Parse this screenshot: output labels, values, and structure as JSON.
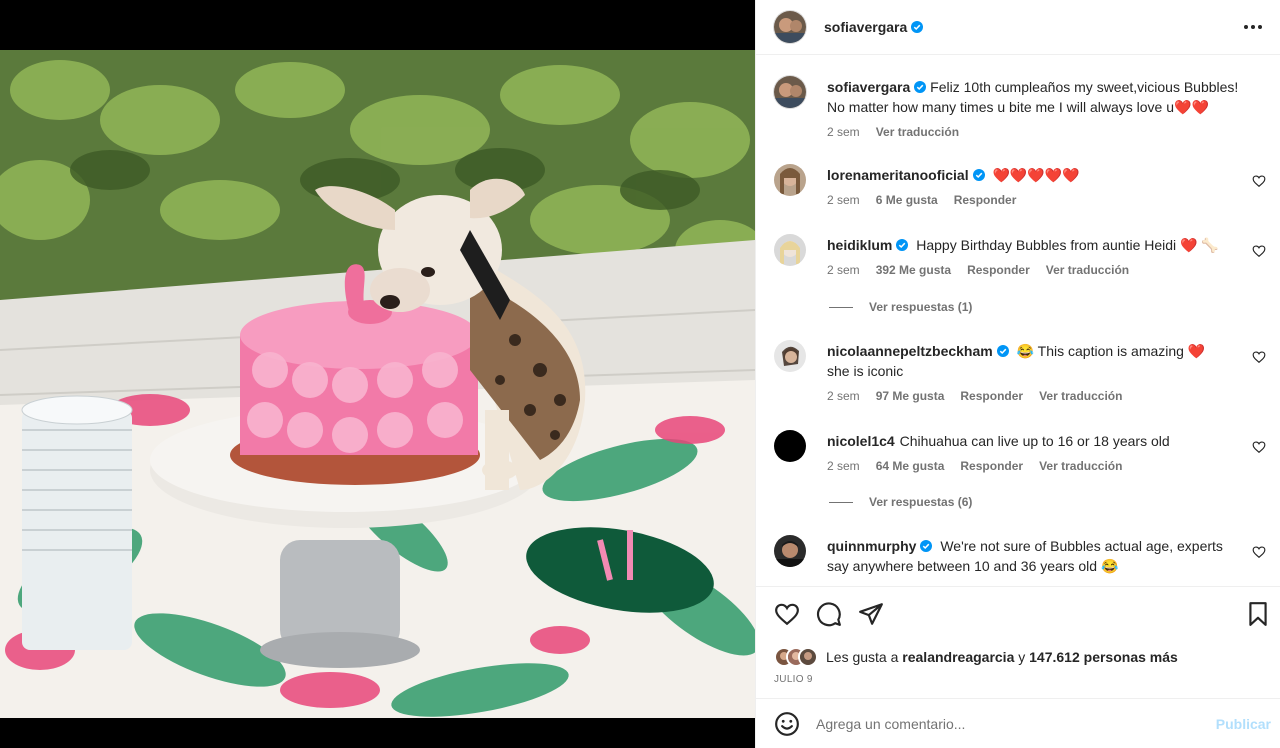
{
  "post": {
    "author": "sofiavergara",
    "caption_author": "sofiavergara",
    "caption_text": "Feliz 10th cumpleaños my sweet,vicious Bubbles! No matter how many times u bite me I will always love u",
    "caption_emoji": "❤️❤️",
    "caption_time": "2 sem",
    "caption_translate": "Ver traducción"
  },
  "comments": [
    {
      "user": "lorenameritanooficial",
      "verified": true,
      "text": "❤️❤️❤️❤️❤️",
      "time": "2 sem",
      "likes": "6 Me gusta",
      "reply": "Responder",
      "translate": ""
    },
    {
      "user": "heidiklum",
      "verified": true,
      "text": "Happy Birthday Bubbles from auntie Heidi ❤️ 🦴",
      "time": "2 sem",
      "likes": "392 Me gusta",
      "reply": "Responder",
      "translate": "Ver traducción",
      "view_replies": "Ver respuestas (1)"
    },
    {
      "user": "nicolaannepeltzbeckham",
      "verified": true,
      "text": "😂 This caption is amazing ❤️ she is iconic",
      "time": "2 sem",
      "likes": "97 Me gusta",
      "reply": "Responder",
      "translate": "Ver traducción"
    },
    {
      "user": "nicolel1c4",
      "verified": false,
      "text": "Chihuahua can live up to 16 or 18 years old",
      "time": "2 sem",
      "likes": "64 Me gusta",
      "reply": "Responder",
      "translate": "Ver traducción",
      "view_replies": "Ver respuestas (6)"
    },
    {
      "user": "quinnmurphy",
      "verified": true,
      "text": "We're not sure of Bubbles actual age, experts say anywhere between 10 and 36 years old 😂",
      "time": "",
      "likes": "",
      "reply": "",
      "translate": ""
    }
  ],
  "likes_summary": {
    "prefix": "Les gusta a",
    "user": "realandreagarcia",
    "joiner": "y",
    "count": "147.612 personas más"
  },
  "date": "JULIO 9",
  "composer": {
    "placeholder": "Agrega un comentario...",
    "post_label": "Publicar"
  },
  "icons": [
    "more-icon",
    "verified-icon",
    "heart-icon",
    "comment-icon",
    "share-icon",
    "save-icon",
    "emoji-icon"
  ],
  "colors": {
    "verified": "#0095f6",
    "heart_red": "#ed4956",
    "muted": "#737373",
    "post_disabled": "#b2dffc"
  }
}
